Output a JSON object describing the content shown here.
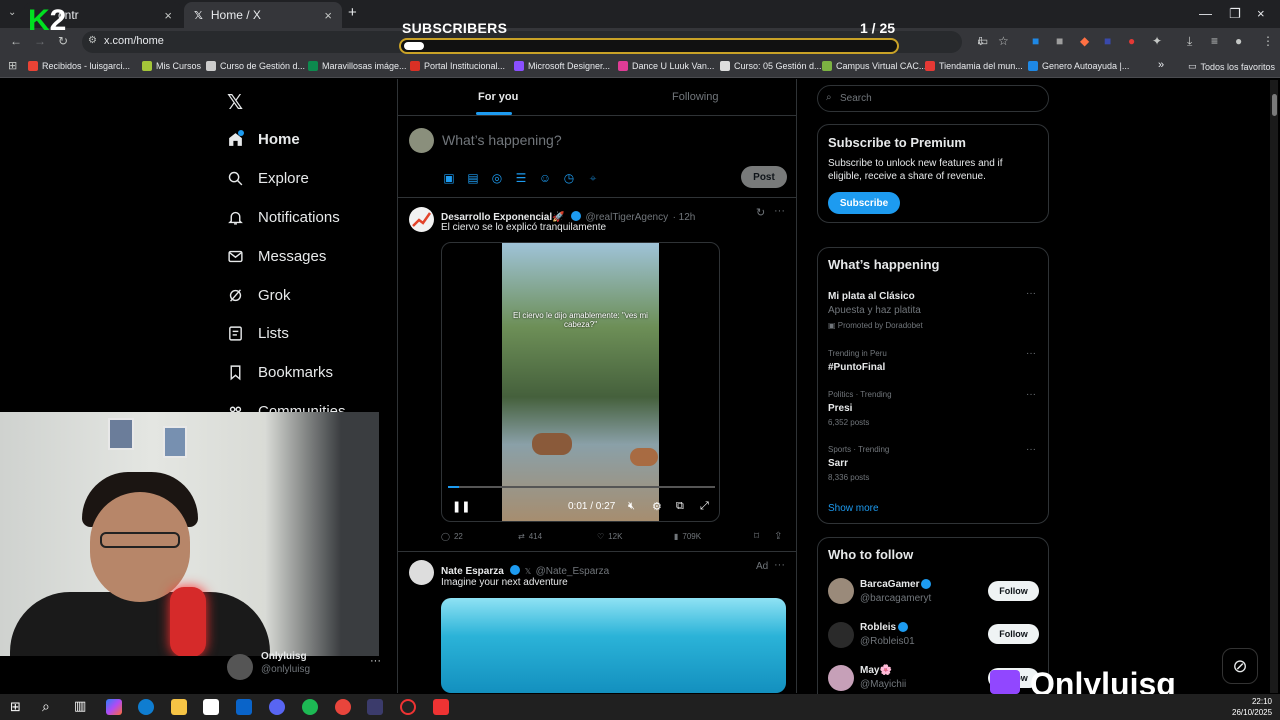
{
  "browser": {
    "tabs": [
      {
        "label": "ontr"
      },
      {
        "label": "Home / X"
      }
    ],
    "url": "x.com/home",
    "new_tab": "+",
    "close": "×",
    "bookmarks": [
      {
        "label": "Recibidos - luisgarci...",
        "color": "#ea4335"
      },
      {
        "label": "Mis Cursos",
        "color": "#a4c639"
      },
      {
        "label": "Curso de Gestión d...",
        "color": "#cccccc"
      },
      {
        "label": "Maravillosas imáge...",
        "color": "#0d8a4e"
      },
      {
        "label": "Portal Institucional...",
        "color": "#d93025"
      },
      {
        "label": "Microsoft Designer...",
        "color": "#8a4fff"
      },
      {
        "label": "Dance U Luuk Van...",
        "color": "#e03c96"
      },
      {
        "label": "Curso: 05 Gestión d...",
        "color": "#dddddd"
      },
      {
        "label": "Campus Virtual CAC...",
        "color": "#7cb342"
      },
      {
        "label": "Tiendamia del mun...",
        "color": "#e53935"
      },
      {
        "label": "Genero Autoayuda |...",
        "color": "#1e88e5"
      }
    ],
    "bookmarks_more": "»",
    "all_bookmarks": "Todos los favoritos"
  },
  "overlay": {
    "logo_k": "K",
    "logo_2": "2",
    "subscribers_title": "SUBSCRIBERS",
    "subscribers_count": "1 / 25",
    "subscribers_progress": 0.04,
    "watermark": "Onlyluisg"
  },
  "nav": {
    "items": [
      {
        "label": "Home",
        "icon": "home-icon",
        "active": true
      },
      {
        "label": "Explore",
        "icon": "search-icon"
      },
      {
        "label": "Notifications",
        "icon": "bell-icon"
      },
      {
        "label": "Messages",
        "icon": "mail-icon"
      },
      {
        "label": "Grok",
        "icon": "grok-icon"
      },
      {
        "label": "Lists",
        "icon": "list-icon"
      },
      {
        "label": "Bookmarks",
        "icon": "bookmark-icon"
      },
      {
        "label": "Communities",
        "icon": "communities-icon"
      }
    ],
    "account_name": "Onlyluisg",
    "account_handle": "@onlyluisg",
    "account_more": "···"
  },
  "feed": {
    "tab_foryou": "For you",
    "tab_following": "Following",
    "compose_placeholder": "What’s happening?",
    "post_button": "Post",
    "tweet1": {
      "name": "Desarrollo Exponencial🚀",
      "handle": "@realTigerAgency",
      "time": "· 12h",
      "text": "El ciervo se lo explicó tranquilamente",
      "video_caption": "El ciervo le dijo amablemente: \"ves mi cabeza?\"",
      "video_time": "0:01 / 0:27",
      "video_progress": 0.04,
      "replies": "22",
      "reposts": "414",
      "likes": "12K",
      "views": "709K"
    },
    "tweet2": {
      "name": "Nate Esparza",
      "handle": "@Nate_Esparza",
      "ad": "Ad",
      "text": "Imagine your next adventure"
    }
  },
  "sidebar": {
    "search_placeholder": "Search",
    "premium": {
      "title": "Subscribe to Premium",
      "desc": "Subscribe to unlock new features and if eligible, receive a share of revenue.",
      "button": "Subscribe"
    },
    "happening": {
      "title": "What’s happening",
      "trends": [
        {
          "meta": "",
          "title": "Mi plata al Clásico",
          "sub": "Apuesta y haz platita",
          "promo": "Promoted by Doradobet"
        },
        {
          "meta": "Trending in Peru",
          "title": "#PuntoFinal",
          "sub": ""
        },
        {
          "meta": "Politics · Trending",
          "title": "Presi",
          "sub": "6,352 posts"
        },
        {
          "meta": "Sports · Trending",
          "title": "Sarr",
          "sub": "8,336 posts"
        }
      ],
      "show_more": "Show more",
      "more": "···"
    },
    "who_to_follow": {
      "title": "Who to follow",
      "accounts": [
        {
          "name": "BarcaGamer",
          "handle": "@barcagameryt",
          "button": "Follow"
        },
        {
          "name": "Robleis",
          "handle": "@Robleis01",
          "button": "Follow"
        },
        {
          "name": "May🌸",
          "handle": "@Mayichii",
          "button": "Follow"
        }
      ]
    }
  },
  "taskbar": {
    "time": "22:10",
    "date": "26/10/2025"
  }
}
